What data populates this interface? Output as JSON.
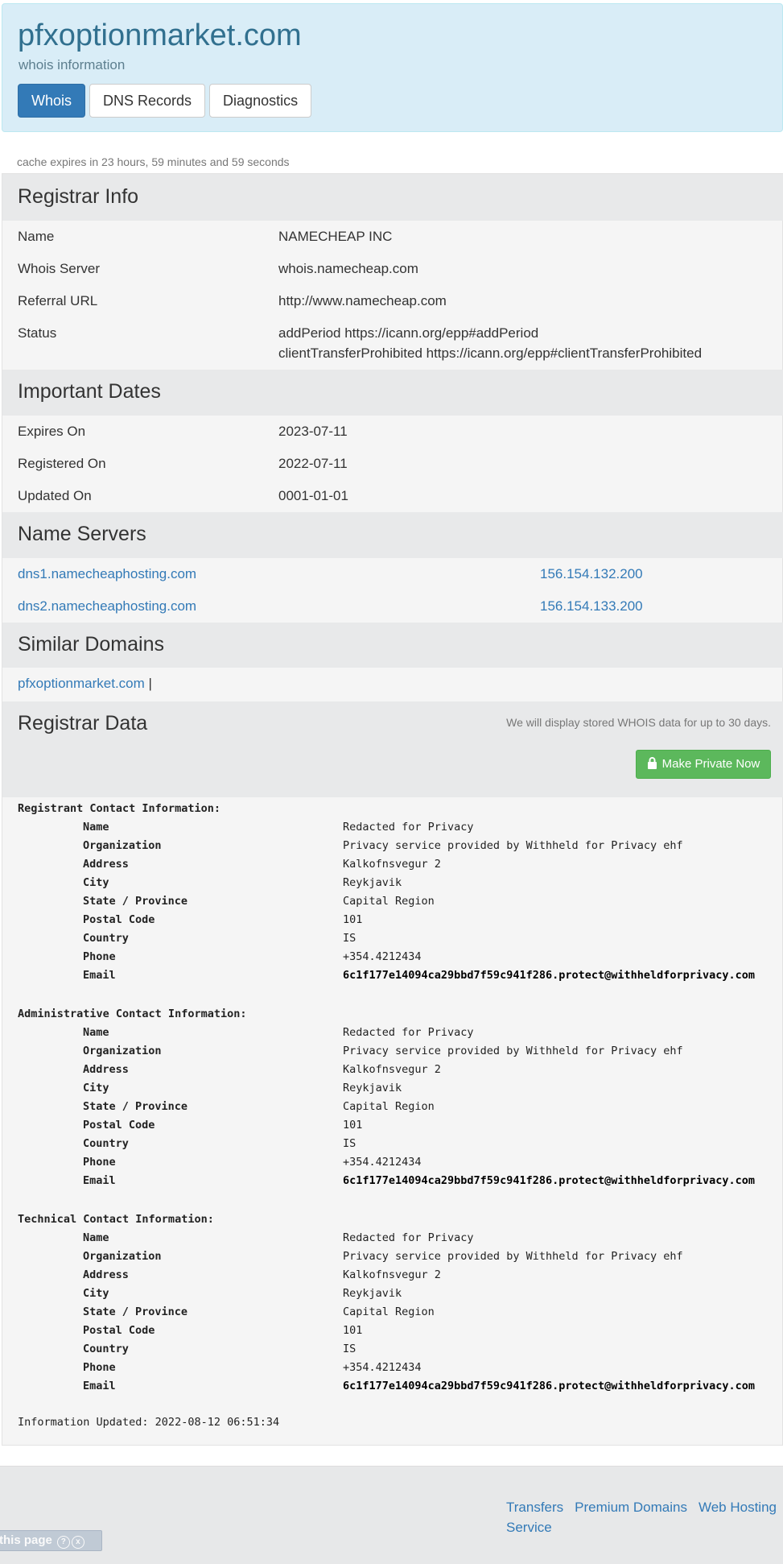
{
  "header": {
    "domain": "pfxoptionmarket.com",
    "subtitle": "whois information",
    "tabs": [
      {
        "label": "Whois",
        "active": true
      },
      {
        "label": "DNS Records",
        "active": false
      },
      {
        "label": "Diagnostics",
        "active": false
      }
    ]
  },
  "cache_notice": "cache expires in 23 hours, 59 minutes and 59 seconds",
  "registrar_info": {
    "title": "Registrar Info",
    "rows": [
      {
        "key": "Name",
        "value": "NAMECHEAP INC"
      },
      {
        "key": "Whois Server",
        "value": "whois.namecheap.com"
      },
      {
        "key": "Referral URL",
        "value": "http://www.namecheap.com"
      },
      {
        "key": "Status",
        "value": "addPeriod https://icann.org/epp#addPeriod",
        "value2": "clientTransferProhibited https://icann.org/epp#clientTransferProhibited"
      }
    ]
  },
  "important_dates": {
    "title": "Important Dates",
    "rows": [
      {
        "key": "Expires On",
        "value": "2023-07-11"
      },
      {
        "key": "Registered On",
        "value": "2022-07-11"
      },
      {
        "key": "Updated On",
        "value": "0001-01-01"
      }
    ]
  },
  "name_servers": {
    "title": "Name Servers",
    "rows": [
      {
        "host": "dns1.namecheaphosting.com",
        "ip": "156.154.132.200"
      },
      {
        "host": "dns2.namecheaphosting.com",
        "ip": "156.154.133.200"
      }
    ]
  },
  "similar_domains": {
    "title": "Similar Domains",
    "link": "pfxoptionmarket.com",
    "separator": "|"
  },
  "registrar_data": {
    "title": "Registrar Data",
    "note": "We will display stored WHOIS data for up to 30 days.",
    "button_label": "Make Private Now",
    "groups": [
      {
        "title": "Registrant Contact Information:",
        "fields": [
          {
            "k": "Name",
            "v": "Redacted for Privacy"
          },
          {
            "k": "Organization",
            "v": "Privacy service provided by Withheld for Privacy ehf"
          },
          {
            "k": "Address",
            "v": "Kalkofnsvegur 2"
          },
          {
            "k": "City",
            "v": "Reykjavik"
          },
          {
            "k": "State / Province",
            "v": "Capital Region"
          },
          {
            "k": "Postal Code",
            "v": "101"
          },
          {
            "k": "Country",
            "v": "IS"
          },
          {
            "k": "Phone",
            "v": "+354.4212434"
          },
          {
            "k": "Email",
            "v": "6c1f177e14094ca29bbd7f59c941f286.protect@withheldforprivacy.com"
          }
        ]
      },
      {
        "title": "Administrative Contact Information:",
        "fields": [
          {
            "k": "Name",
            "v": "Redacted for Privacy"
          },
          {
            "k": "Organization",
            "v": "Privacy service provided by Withheld for Privacy ehf"
          },
          {
            "k": "Address",
            "v": "Kalkofnsvegur 2"
          },
          {
            "k": "City",
            "v": "Reykjavik"
          },
          {
            "k": "State / Province",
            "v": "Capital Region"
          },
          {
            "k": "Postal Code",
            "v": "101"
          },
          {
            "k": "Country",
            "v": "IS"
          },
          {
            "k": "Phone",
            "v": "+354.4212434"
          },
          {
            "k": "Email",
            "v": "6c1f177e14094ca29bbd7f59c941f286.protect@withheldforprivacy.com"
          }
        ]
      },
      {
        "title": "Technical Contact Information:",
        "fields": [
          {
            "k": "Name",
            "v": "Redacted for Privacy"
          },
          {
            "k": "Organization",
            "v": "Privacy service provided by Withheld for Privacy ehf"
          },
          {
            "k": "Address",
            "v": "Kalkofnsvegur 2"
          },
          {
            "k": "City",
            "v": "Reykjavik"
          },
          {
            "k": "State / Province",
            "v": "Capital Region"
          },
          {
            "k": "Postal Code",
            "v": "101"
          },
          {
            "k": "Country",
            "v": "IS"
          },
          {
            "k": "Phone",
            "v": "+354.4212434"
          },
          {
            "k": "Email",
            "v": "6c1f177e14094ca29bbd7f59c941f286.protect@withheldforprivacy.com"
          }
        ]
      }
    ],
    "updated": "Information Updated: 2022-08-12 06:51:34"
  },
  "footer": {
    "links": [
      "Transfers",
      "Premium Domains",
      "Web Hosting",
      "Service"
    ]
  },
  "badge": {
    "label": "this page",
    "icons": [
      "?",
      "x"
    ]
  },
  "colors": {
    "accent": "#337ab7",
    "success": "#5cb85c",
    "hero_bg": "#d9edf7"
  }
}
